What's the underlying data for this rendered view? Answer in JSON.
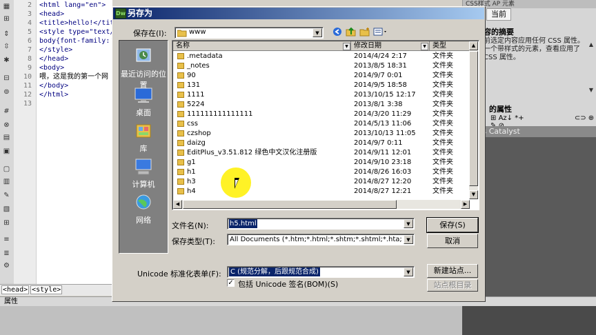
{
  "colors": {
    "title_gradient_start": "#0a246a",
    "title_gradient_end": "#a6caf0",
    "selection": "#0a246a",
    "cursor_highlight": "#fff000",
    "folder": "#e8c04a"
  },
  "editor": {
    "line_numbers": [
      "2",
      "3",
      "4",
      "5",
      "6",
      "7",
      "8",
      "9",
      "10",
      "11",
      "12",
      "13"
    ],
    "code_lines": [
      "<html lang=\"en\">",
      "<head>",
      "<title>hello!</tit",
      "<style type=\"text/",
      "body{font-family:'",
      "</style>",
      "</head>",
      "<body>",
      "喂，这是我的第一个网",
      "</body>",
      "</html>",
      ""
    ],
    "tag_selector": [
      "<head>",
      "<style>"
    ],
    "properties_label": "属性"
  },
  "right_panel": {
    "tabs_text": "CSS样式  AP 元素",
    "current_tab": "当前",
    "summary_title": "容的摘要",
    "summary_lines": [
      "前选定内容应用任何 CSS 属性。",
      "一个带样式的元素，查看应用了",
      "CSS 属性。"
    ],
    "props_title": "的属性",
    "catalyst": "ess Catalyst"
  },
  "dialog": {
    "title": "另存为",
    "app_icon": "Dw",
    "save_in_label": "保存在(I):",
    "save_in_value": "www",
    "nav_icons": [
      "back-icon",
      "up-folder-icon",
      "new-folder-icon",
      "view-menu-icon"
    ],
    "places": [
      {
        "name": "recent-places",
        "label": "最近访问的位置"
      },
      {
        "name": "desktop",
        "label": "桌面"
      },
      {
        "name": "library",
        "label": "库"
      },
      {
        "name": "computer",
        "label": "计算机"
      },
      {
        "name": "network",
        "label": "网络"
      }
    ],
    "columns": {
      "name": "名称",
      "date": "修改日期",
      "type": "类型"
    },
    "files": [
      {
        "name": ".metadata",
        "date": "2014/4/24 2:17",
        "type": "文件夹"
      },
      {
        "name": "_notes",
        "date": "2013/8/5 18:31",
        "type": "文件夹"
      },
      {
        "name": "90",
        "date": "2014/9/7 0:01",
        "type": "文件夹"
      },
      {
        "name": "131",
        "date": "2014/9/5 18:58",
        "type": "文件夹"
      },
      {
        "name": "1111",
        "date": "2013/10/15 12:17",
        "type": "文件夹"
      },
      {
        "name": "5224",
        "date": "2013/8/1 3:38",
        "type": "文件夹"
      },
      {
        "name": "111111111111111",
        "date": "2014/3/20 11:29",
        "type": "文件夹"
      },
      {
        "name": "css",
        "date": "2014/5/13 11:06",
        "type": "文件夹"
      },
      {
        "name": "czshop",
        "date": "2013/10/13 11:05",
        "type": "文件夹"
      },
      {
        "name": "daizg",
        "date": "2014/9/7 0:11",
        "type": "文件夹"
      },
      {
        "name": "EditPlus_v3.51.812 绿色中文汉化注册版",
        "date": "2014/9/11 12:01",
        "type": "文件夹"
      },
      {
        "name": "g1",
        "date": "2014/9/10 23:18",
        "type": "文件夹"
      },
      {
        "name": "h1",
        "date": "2014/8/26 16:03",
        "type": "文件夹"
      },
      {
        "name": "h3",
        "date": "2014/8/27 12:20",
        "type": "文件夹"
      },
      {
        "name": "h4",
        "date": "2014/8/27 12:21",
        "type": "文件夹"
      }
    ],
    "filename_label": "文件名(N):",
    "filename_value": "h5.html",
    "filetype_label": "保存类型(T):",
    "filetype_value": "All Documents (*.htm;*.html;*.shtm;*.shtml;*.hta;*",
    "unicode_label": "Unicode 标准化表单(F):",
    "unicode_value": "C (规范分解，后跟规范合成)",
    "bom_label": "包括 Unicode 签名(BOM)(S)",
    "bom_checked": "✓",
    "buttons": {
      "save": "保存(S)",
      "cancel": "取消",
      "new_site": "新建站点...",
      "site_root": "站点根目录"
    }
  }
}
